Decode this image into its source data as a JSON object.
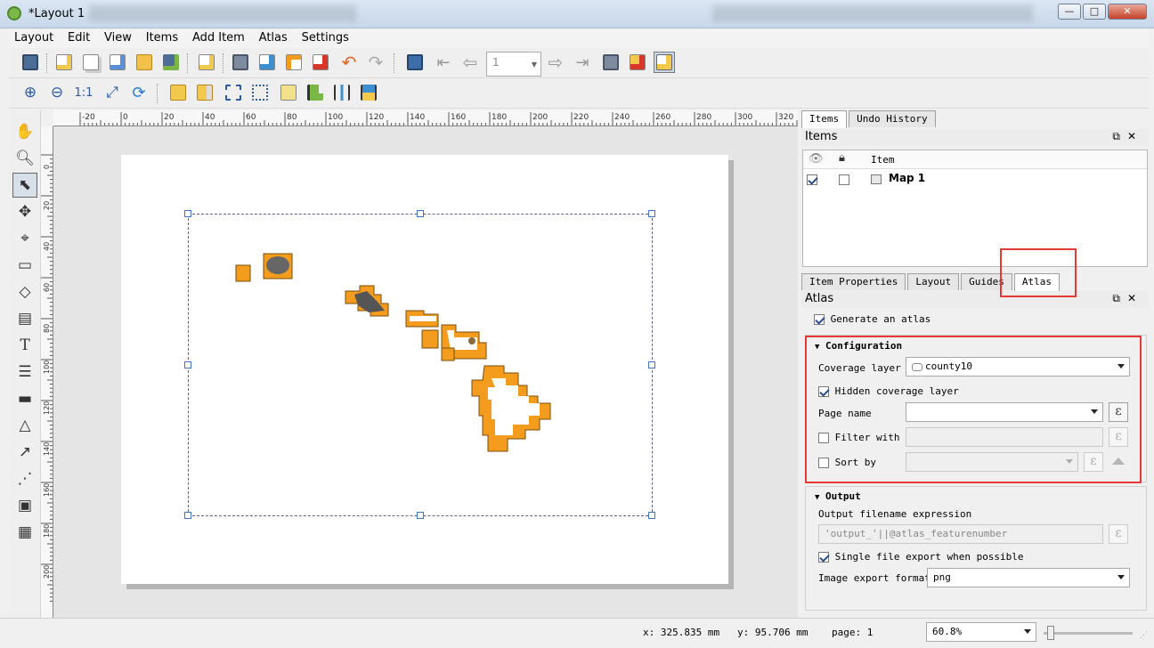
{
  "window": {
    "title": "*Layout 1",
    "buttons": {
      "minimize": "—",
      "maximize": "□",
      "close": "✕"
    }
  },
  "menu": [
    {
      "label": "Layout"
    },
    {
      "label": "Edit"
    },
    {
      "label": "View"
    },
    {
      "label": "Items"
    },
    {
      "label": "Add Item"
    },
    {
      "label": "Atlas"
    },
    {
      "label": "Settings"
    }
  ],
  "toolbar": {
    "atlas_page_value": "1",
    "icons": [
      "save-icon",
      "new-layout-icon",
      "duplicate-layout-icon",
      "layout-manager-icon",
      "open-template-icon",
      "save-template-icon",
      "new-page-icon",
      "print-icon",
      "export-image-icon",
      "export-svg-icon",
      "export-pdf-icon",
      "undo-icon",
      "redo-icon",
      "atlas-preview-icon",
      "first-feature-icon",
      "previous-feature-icon",
      "next-feature-icon",
      "last-feature-icon",
      "print-atlas-icon",
      "export-atlas-icon",
      "atlas-settings-icon"
    ]
  },
  "ruler": {
    "h_labels": [
      "-20",
      "0",
      "20",
      "40",
      "60",
      "80",
      "100",
      "120",
      "140",
      "160",
      "180",
      "200",
      "220",
      "240",
      "260",
      "280",
      "300",
      "320"
    ],
    "v_labels": [
      "0",
      "20",
      "40",
      "60",
      "80",
      "100",
      "120",
      "140",
      "160",
      "180",
      "200"
    ]
  },
  "items_panel": {
    "tabs": [
      "Items",
      "Undo History"
    ],
    "title": "Items",
    "column_item": "Item",
    "rows": [
      {
        "name": "Map 1",
        "visible": true,
        "locked": false
      }
    ]
  },
  "props_tabs": [
    "Item Properties",
    "Layout",
    "Guides",
    "Atlas"
  ],
  "atlas": {
    "title": "Atlas",
    "generate_label": "Generate an atlas",
    "generate_checked": true,
    "configuration": {
      "title": "Configuration",
      "coverage_label": "Coverage layer",
      "coverage_value": "county10",
      "hidden_label": "Hidden coverage layer",
      "hidden_checked": true,
      "page_name_label": "Page name",
      "page_name_value": "",
      "filter_label": "Filter with",
      "filter_checked": false,
      "sort_label": "Sort by",
      "sort_checked": false
    },
    "output": {
      "title": "Output",
      "filename_label": "Output filename expression",
      "filename_value": "'output_'||@atlas_featurenumber",
      "single_file_label": "Single file export when possible",
      "single_file_checked": true,
      "format_label": "Image export format",
      "format_value": "png"
    }
  },
  "status": {
    "x": "x: 325.835 mm",
    "y": "y: 95.706 mm",
    "page": "page: 1",
    "zoom": "60.8%"
  },
  "colors": {
    "island_fill": "#f39c1d",
    "highlight": "#e53935",
    "selection_handle": "#3a78c2"
  }
}
